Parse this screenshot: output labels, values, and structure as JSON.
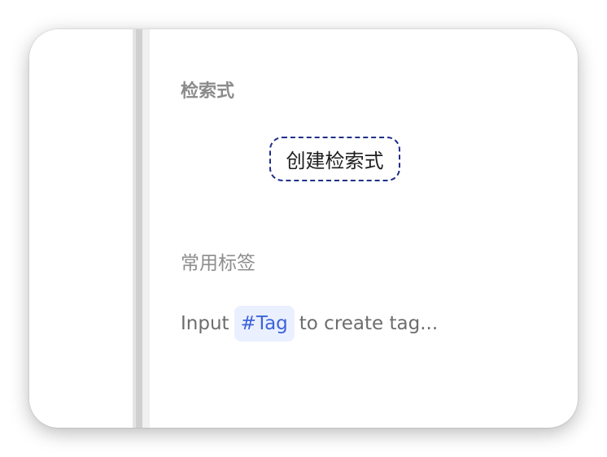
{
  "search_section": {
    "title": "检索式",
    "create_button_label": "创建检索式"
  },
  "tags_section": {
    "title": "常用标签",
    "hint_prefix": "Input",
    "hint_tag": "#Tag",
    "hint_suffix": "to create tag..."
  },
  "colors": {
    "chip_background": "#eaf0ff",
    "chip_text": "#3d63d8",
    "button_border": "#1f2f8a"
  }
}
